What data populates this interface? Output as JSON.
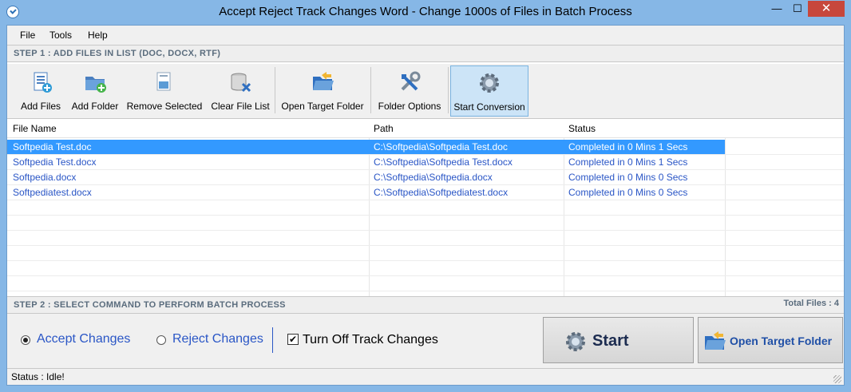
{
  "window": {
    "title": "Accept Reject Track Changes Word - Change 1000s of Files in Batch Process",
    "minimize": "—",
    "maximize": "☐",
    "close": "✕"
  },
  "menu": [
    "File",
    "Tools",
    "Help"
  ],
  "step1": {
    "label": "STEP 1 : ADD FILES IN LIST (DOC, DOCX, RTF)"
  },
  "toolbar": {
    "buttons": [
      {
        "label": "Add Files",
        "icon": "add-files-icon"
      },
      {
        "label": "Add Folder",
        "icon": "add-folder-icon"
      },
      {
        "label": "Remove Selected",
        "icon": "remove-selected-icon"
      },
      {
        "label": "Clear File List",
        "icon": "clear-list-icon"
      },
      {
        "label": "Open Target Folder",
        "icon": "open-folder-icon"
      },
      {
        "label": "Folder Options",
        "icon": "tools-icon"
      },
      {
        "label": "Start Conversion",
        "icon": "gear-icon"
      }
    ]
  },
  "grid": {
    "columns": [
      "File Name",
      "Path",
      "Status"
    ],
    "rows": [
      {
        "name": "Softpedia Test.doc",
        "path": "C:\\Softpedia\\Softpedia Test.doc",
        "status": "Completed in 0 Mins 1 Secs"
      },
      {
        "name": "Softpedia Test.docx",
        "path": "C:\\Softpedia\\Softpedia Test.docx",
        "status": "Completed in 0 Mins 1 Secs"
      },
      {
        "name": "Softpedia.docx",
        "path": "C:\\Softpedia\\Softpedia.docx",
        "status": "Completed in 0 Mins 0 Secs"
      },
      {
        "name": "Softpediatest.docx",
        "path": "C:\\Softpedia\\Softpediatest.docx",
        "status": "Completed in 0 Mins 0 Secs"
      }
    ]
  },
  "step2": {
    "label": "STEP 2 : SELECT COMMAND TO PERFORM BATCH PROCESS",
    "total": "Total Files : 4"
  },
  "options": {
    "accept": "Accept Changes",
    "reject": "Reject Changes",
    "turn_off": "Turn Off Track Changes",
    "selected": "accept",
    "turn_off_checked": true
  },
  "actions": {
    "start": "Start",
    "open_target": "Open Target Folder"
  },
  "statusbar": {
    "text": "Status  :  Idle!"
  },
  "colors": {
    "accent": "#3399ff",
    "link_text": "#2a56c6",
    "window_frame": "#86b7e6",
    "close": "#c7473c"
  }
}
